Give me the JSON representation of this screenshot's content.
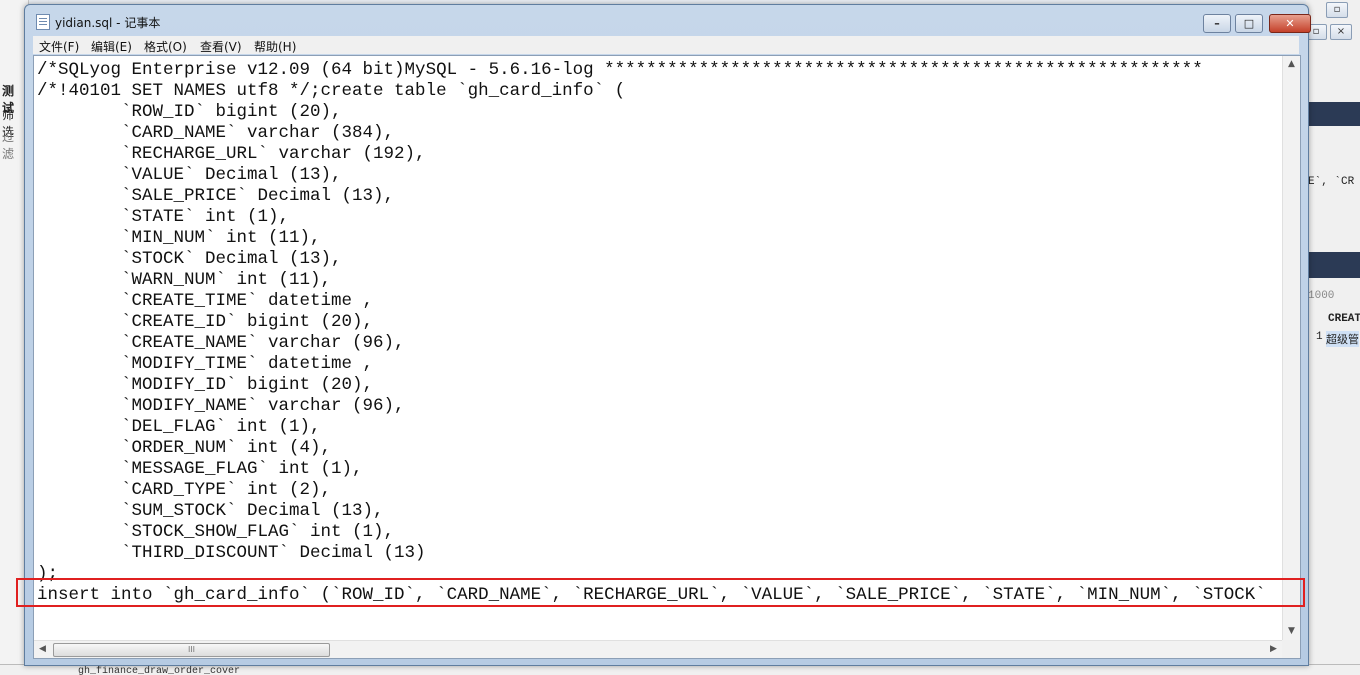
{
  "background": {
    "left_labels": [
      "测试",
      "筛选",
      "过滤"
    ],
    "right_fragments": [
      "E`, `CR",
      "1000",
      "CREAT",
      "1",
      "超级管"
    ],
    "bottom_fragment": "gh_finance_draw_order_cover"
  },
  "window": {
    "title": "yidian.sql - 记事本",
    "controls": {
      "min": "–",
      "max": "□",
      "close": "✕"
    }
  },
  "menu": [
    {
      "label": "文件(F)"
    },
    {
      "label": "编辑(E)"
    },
    {
      "label": "格式(O)"
    },
    {
      "label": "查看(V)"
    },
    {
      "label": "帮助(H)"
    }
  ],
  "editor": {
    "lines": [
      "/*SQLyog Enterprise v12.09 (64 bit)MySQL - 5.6.16-log *********************************************************",
      "/*!40101 SET NAMES utf8 */;create table `gh_card_info` (",
      "        `ROW_ID` bigint (20),",
      "        `CARD_NAME` varchar (384),",
      "        `RECHARGE_URL` varchar (192),",
      "        `VALUE` Decimal (13),",
      "        `SALE_PRICE` Decimal (13),",
      "        `STATE` int (1),",
      "        `MIN_NUM` int (11),",
      "        `STOCK` Decimal (13),",
      "        `WARN_NUM` int (11),",
      "        `CREATE_TIME` datetime ,",
      "        `CREATE_ID` bigint (20),",
      "        `CREATE_NAME` varchar (96),",
      "        `MODIFY_TIME` datetime ,",
      "        `MODIFY_ID` bigint (20),",
      "        `MODIFY_NAME` varchar (96),",
      "        `DEL_FLAG` int (1),",
      "        `ORDER_NUM` int (4),",
      "        `MESSAGE_FLAG` int (1),",
      "        `CARD_TYPE` int (2),",
      "        `SUM_STOCK` Decimal (13),",
      "        `STOCK_SHOW_FLAG` int (1),",
      "        `THIRD_DISCOUNT` Decimal (13)",
      ");",
      "insert into `gh_card_info` (`ROW_ID`, `CARD_NAME`, `RECHARGE_URL`, `VALUE`, `SALE_PRICE`, `STATE`, `MIN_NUM`, `STOCK`"
    ],
    "hscroll_thumb_glyph": "III"
  }
}
